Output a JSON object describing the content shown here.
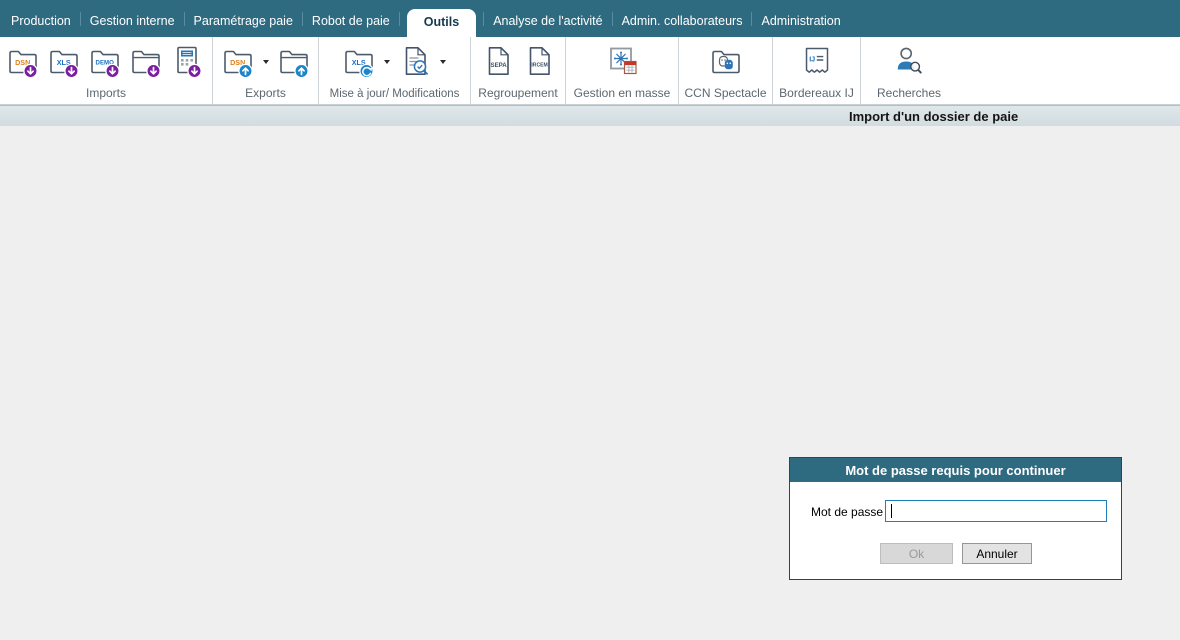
{
  "menu": {
    "tabs": [
      {
        "label": "Production",
        "active": false
      },
      {
        "label": "Gestion interne",
        "active": false
      },
      {
        "label": "Paramétrage paie",
        "active": false
      },
      {
        "label": "Robot de paie",
        "active": false
      },
      {
        "label": "Outils",
        "active": true
      },
      {
        "label": "Analyse de l'activité",
        "active": false
      },
      {
        "label": "Admin. collaborateurs",
        "active": false
      },
      {
        "label": "Administration",
        "active": false
      }
    ]
  },
  "ribbon": {
    "groups": [
      {
        "label": "Imports"
      },
      {
        "label": "Exports"
      },
      {
        "label": "Mise à jour/ Modifications"
      },
      {
        "label": "Regroupement"
      },
      {
        "label": "Gestion en masse"
      },
      {
        "label": "CCN Spectacle"
      },
      {
        "label": "Bordereaux IJ"
      },
      {
        "label": "Recherches"
      }
    ],
    "icon_texts": {
      "dsn": "DSN",
      "xls": "XLS",
      "demo": "DEMO",
      "sepa": "SEPA",
      "ircem": "IRCEM",
      "ij": "IJ"
    }
  },
  "subheader": {
    "title": "Import d'un dossier de paie"
  },
  "dialog": {
    "title": "Mot de passe requis pour continuer",
    "field_label": "Mot de passe",
    "input_value": "",
    "ok_label": "Ok",
    "cancel_label": "Annuler"
  },
  "colors": {
    "accent_teal": "#2e6a80",
    "badge_import": "#7b1fa2",
    "badge_export": "#1b87c9",
    "input_border": "#1f7fb4"
  }
}
